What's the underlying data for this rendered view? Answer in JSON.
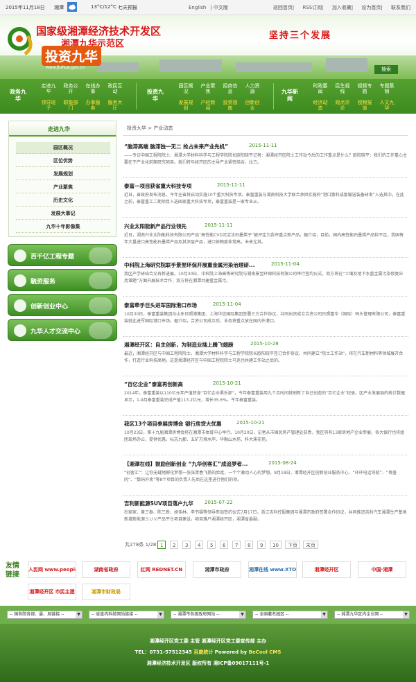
{
  "topbar": {
    "date": "2015年11月18日",
    "city": "湘潭",
    "temp": "13°C/12°C",
    "forecast": "七天预报",
    "lang": [
      "English",
      "中文版"
    ],
    "links": [
      "返回首页",
      "RSS订阅",
      "加入收藏",
      "设为首页",
      "联系我们"
    ]
  },
  "banner": {
    "title1": "国家级湘潭经济技术开发区",
    "title2": "湘潭九华示范区",
    "title3": "投资九华",
    "site": "www.jiuhua.gov.cn",
    "slogan": "坚持三个发展",
    "search": "搜索"
  },
  "nav": {
    "groups": [
      {
        "label": "政务九华",
        "items": [
          [
            "走进九华",
            "领导班子"
          ],
          [
            "政务公开",
            "职能部门"
          ],
          [
            "在线办事",
            "办事服务"
          ],
          [
            "政民互动",
            "服务大厅"
          ]
        ]
      },
      {
        "label": "投资九华",
        "items": [
          [
            "园区概况",
            "发展规划"
          ],
          [
            "产业聚焦",
            "产经新闻"
          ],
          [
            "招商信息",
            "投资指南"
          ],
          [
            "人力资源",
            "创新创业"
          ]
        ]
      },
      {
        "label": "九华新闻",
        "items": [
          [
            "时政要闻",
            "经济动态"
          ],
          [
            "民生视线",
            "观点评论"
          ],
          [
            "视频专题",
            "视频报道"
          ],
          [
            "专题集锦",
            "人文九华"
          ]
        ]
      }
    ]
  },
  "sidebar": {
    "heading": "走进九华",
    "items": [
      "园区概况",
      "区位优势",
      "发展规划",
      "产业聚焦",
      "历史文化",
      "发展大事记",
      "九华十年影像集"
    ],
    "buttons": [
      "百千亿工程专题",
      "融资服务",
      "创新创业中心",
      "九华人才交流中心"
    ]
  },
  "breadcrumb": "投资九华 > 产业动态",
  "news": [
    {
      "title": "“脑滞高端 脑滞独一无二 抢占未来产业先机”",
      "date": "2015-11-11",
      "desc": "——专访中国工程院院士、湘潭大学材料科学与工程学院院长欧阳晓平记者：湘潭经开区院士工作站今后的工作重点是什么？欧阳晓平：我们的工作重心主要在于产业化前期研究项目。我们将与经开区的主导产业紧密结合，比方。"
    },
    {
      "title": "泰富一项目获省重大科技专项",
      "date": "2015-11-11",
      "desc": "近日，省政府发布消息，今年全省将启动实施10个重大科技专项。泰富重装与湖南科技大学联合承担实施的“港口散料成套输送装备研发”入选其中。在此之前，泰富重工二期项目入选国家重大科技专项，泰富重装是一家专业从。"
    },
    {
      "title": "兴业太阳能新产品行业领先",
      "date": "2015-11-11",
      "desc": "近日，湖南兴业太阳能科技有限公司产品“高性能CVD沉淀法石墨烯子”被评定为我市重点新产品。据介绍，目前，国内高性能石墨烯产品较不足，我国每年大量进口高性能石墨烯产品及其涂层产品，进口依赖度非常高，未来尤其。"
    },
    {
      "title": "中科院上海研究院联手景翌环保开展重金属污染治理研...",
      "date": "2015-11-04",
      "desc": "我区产学研结合又有新进展。10月30日，中科院上海高等研究院与湖南景翌环保科技有限公司举行签约仪式，双方将在“土壤及地下水重金属污染修复应用课题”方面开展技术合作，双方将在湘潭共建重金属污。"
    },
    {
      "title": "泰富牵手巨头进军国际港口市场",
      "date": "2015-11-04",
      "desc": "10月30日，泰富重装集团与山东日照港集团、上海华信国际集团签署三方合作协议，共同出资成立合资公司日照富华（国际）码头管理有限公司，泰富重装就此进军国际港口市场。据介绍，合资公司成立后，业务将重点放在国内外港口。"
    },
    {
      "title": "湘潭经开区：自主创新，为制造业插上腾飞翅膀",
      "date": "2015-10-28",
      "desc": "最近，湘潭经开区与中国工程院院士、湘潭大学材料科学与工程学院院长欧阳晓平签订合作协议，共同建立“院士工作站”，将在汽车新材料等领域展开合作，打造行业科技高地。这是湘潭经开区与中国工程院院士马克也共建工作站之后的。"
    },
    {
      "title": "“百亿企业”泰富再创新高",
      "date": "2015-10-21",
      "desc": "2014年，泰富重装以110亿元年产值跻身“百亿企业俱乐部”，今年泰富重装用九个月时间就刷新了自己创造的“百亿企业”纪录。区产业发展局的统计数据显示，1-9月泰富重装完成产值113.2亿元，增长35.6%。今年泰富重装。"
    },
    {
      "title": "我区13个项目参展房博会 银行房贷大优惠",
      "date": "2015-10-21",
      "desc": "10月23日，第十九届湘潭房博会将在湘潭市体育中心举行。10月20日，记者从市国民房产管理处获悉，我区将有13家房地产企业参展，各大银行也将组团现场办公，提供优惠。标志九郡、五矿万境水岸、华融山水苑、科大溪花苑。"
    },
    {
      "title": "【湘潭在线】鼓励创新创业 “九华创客汇”成追梦者...",
      "date": "2015-08-24",
      "desc": "“创客汇”：让你无缝地孵化梦想一张张青春飞扬的脸庞，一个个激动人心的梦想。8月18日，湘潭经开区创新创业服务中心、“环环电话导航”、“哥盛冈”、“数码外卖”等8个项目的负责人先后在这里进行他们的项。"
    },
    {
      "title": "吉利新能源SUV项目落户九华",
      "date": "2015-07-22",
      "desc": "杜家家、黄三泰、陈三新、胡伟林、李书福等领导参加签约仪式7月17日，浙江吉利控股集团与湘潭市政府签署合作协议，共同推进吉利汽车湘潭生产基地新增新能源ＳＵＶ产品平台项目建设。项目落户湘潭经开区，湘潭省委副。"
    }
  ],
  "pager": {
    "total": "共278条 1/28",
    "pages": [
      "1",
      "2",
      "3",
      "4",
      "5",
      "6",
      "7",
      "8",
      "9",
      "10"
    ],
    "next": "下页",
    "last": "末页",
    "current": "1"
  },
  "friends": {
    "label": "友情链接",
    "links": [
      {
        "name": "人民网 www.people.com.cn",
        "color": "#d51a1a"
      },
      {
        "name": "湖南省政府",
        "color": "#c8161d"
      },
      {
        "name": "红网 REDNET.CN",
        "color": "#c8161d"
      },
      {
        "name": "湘潭市政府",
        "color": "#333333"
      },
      {
        "name": "湘潭在线 www.XTOL.CN",
        "color": "#2a6ea8"
      },
      {
        "name": "湘潭经开区",
        "color": "#d51a1a"
      },
      {
        "name": "中国·湘潭",
        "color": "#c8161d"
      },
      {
        "name": "湘潭经开区 市民主建",
        "color": "#d51a1a"
      },
      {
        "name": "湘潭市财政局",
        "color": "#c79a00"
      }
    ]
  },
  "selects": [
    "-- 国务院各部、委、局链接 --",
    "-- 省直内科技网站链接 --",
    "-- 湘潭市各级政府网站 --",
    "-- 全国著名园区 --",
    "-- 湘潭九华区内企业网 --"
  ],
  "footer": {
    "line1": "湘潭经开区党工委 主管 湘潭经开区党工委宣传部 主办",
    "line2a": "TEL：0731-57512345",
    "line2b": "百度统计",
    "line2c": "Powered by",
    "line2d": "BeCool CMS",
    "line3": "湘潭经济技术开发区 版权所有 湘ICP备09017111号-1"
  }
}
